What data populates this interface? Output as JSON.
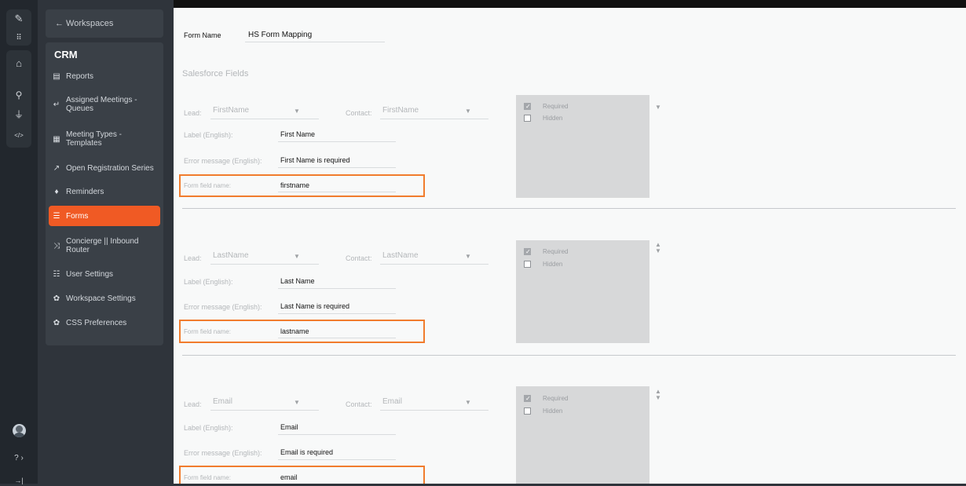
{
  "rail": {
    "items": [
      {
        "name": "brand-logo-icon",
        "glyph": "✎"
      },
      {
        "name": "apps-grid-icon",
        "glyph": "⠿"
      },
      {
        "name": "home-icon",
        "glyph": "⌂"
      },
      {
        "name": "user-icon",
        "glyph": "⚲"
      },
      {
        "name": "plug-icon",
        "glyph": "⏚"
      },
      {
        "name": "code-icon",
        "glyph": "</>"
      },
      {
        "name": "help-icon",
        "glyph": "? ›"
      },
      {
        "name": "expand-icon",
        "glyph": "→|"
      }
    ]
  },
  "sidebar": {
    "back_label": "← Workspaces",
    "section_title": "CRM",
    "items": [
      {
        "label": "Reports",
        "icon": "▤",
        "name": "sidebar-item-reports",
        "icon_name": "reports-icon",
        "active": false
      },
      {
        "label": "Assigned Meetings -\nQueues",
        "icon": "↵",
        "name": "sidebar-item-assigned-meetings-queues",
        "icon_name": "queue-icon",
        "active": false
      },
      {
        "label": "Meeting Types -\nTemplates",
        "icon": "▦",
        "name": "sidebar-item-meeting-types-templates",
        "icon_name": "calendar-icon",
        "active": false
      },
      {
        "label": "Open Registration Series",
        "icon": "↗",
        "name": "sidebar-item-open-registration-series",
        "icon_name": "arrow-icon",
        "active": false
      },
      {
        "label": "Reminders",
        "icon": "♦",
        "name": "sidebar-item-reminders",
        "icon_name": "bell-icon",
        "active": false
      },
      {
        "label": "Forms",
        "icon": "☰",
        "name": "sidebar-item-forms",
        "icon_name": "forms-icon",
        "active": true
      },
      {
        "label": "Concierge || Inbound\nRouter",
        "icon": "⤨",
        "name": "sidebar-item-concierge-inbound-router",
        "icon_name": "shuffle-icon",
        "active": false
      },
      {
        "label": "User Settings",
        "icon": "☷",
        "name": "sidebar-item-user-settings",
        "icon_name": "users-icon",
        "active": false
      },
      {
        "label": "Workspace Settings",
        "icon": "✿",
        "name": "sidebar-item-workspace-settings",
        "icon_name": "gear-icon",
        "active": false
      },
      {
        "label": "CSS Preferences",
        "icon": "✿",
        "name": "sidebar-item-css-preferences",
        "icon_name": "gear-icon",
        "active": false
      }
    ]
  },
  "form": {
    "form_name_label": "Form Name",
    "form_name_value": "HS Form Mapping",
    "section_title": "Salesforce Fields",
    "labels": {
      "lead": "Lead:",
      "contact": "Contact:",
      "label_english": "Label (English):",
      "error_english": "Error message (English):",
      "form_field_name": "Form field name:",
      "required": "Required",
      "hidden": "Hidden"
    },
    "fields": [
      {
        "lead": "FirstName",
        "contact": "FirstName",
        "label": "First Name",
        "error": "First Name is required",
        "field_name": "firstname",
        "required": true,
        "hidden": false
      },
      {
        "lead": "LastName",
        "contact": "LastName",
        "label": "Last Name",
        "error": "Last Name is required",
        "field_name": "lastname",
        "required": true,
        "hidden": false
      },
      {
        "lead": "Email",
        "contact": "Email",
        "label": "Email",
        "error": "Email is required",
        "field_name": "email",
        "required": true,
        "hidden": false
      }
    ]
  },
  "colors": {
    "accent": "#f05a24",
    "highlight_border": "#f17c2d"
  }
}
